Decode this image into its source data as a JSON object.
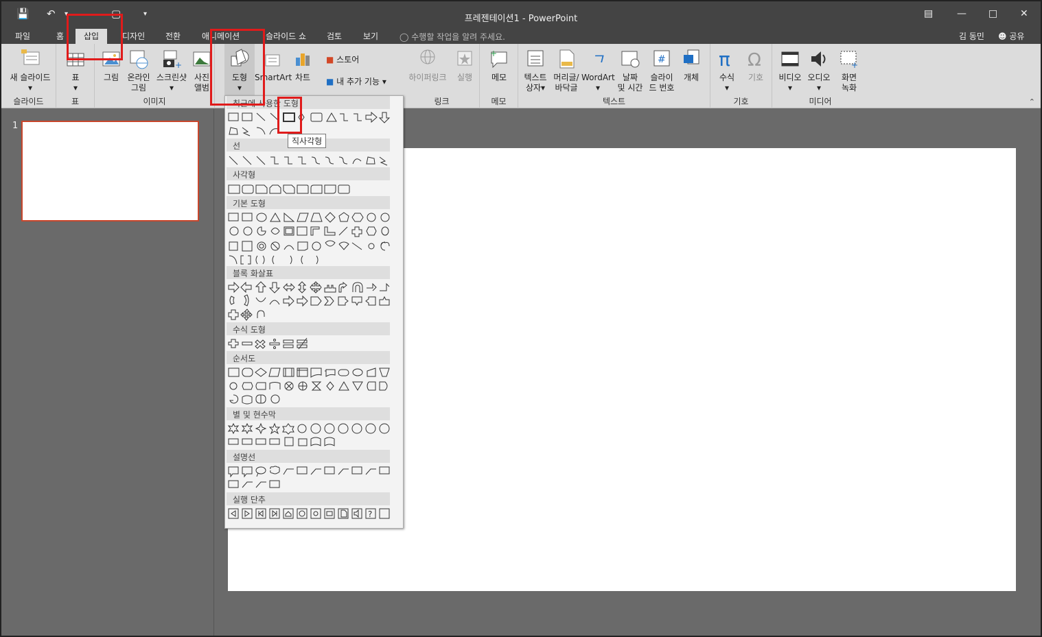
{
  "app": {
    "title": "프레젠테이션1 - PowerPoint",
    "user": "김 동민",
    "share": "공유",
    "tell_me": "수행할 작업을 알려 주세요."
  },
  "tabs": [
    "파일",
    "홈",
    "삽입",
    "디자인",
    "전환",
    "애니메이션",
    "슬라이드 쇼",
    "검토",
    "보기"
  ],
  "ribbon": {
    "groups": {
      "slides": "슬라이드",
      "table": "표",
      "images": "이미지",
      "links": "링크",
      "comments": "메모",
      "text": "텍스트",
      "symbols": "기호",
      "media": "미디어"
    },
    "buttons": {
      "new_slide": "새 슬라이드",
      "table": "표",
      "pictures": "그림",
      "online_pictures": [
        "온라인",
        "그림"
      ],
      "screenshot": "스크린샷",
      "photo_album": [
        "사진",
        "앨범"
      ],
      "shapes": "도형",
      "smartart": "SmartArt",
      "chart": "차트",
      "store": "스토어",
      "my_addins": "내 추가 기능",
      "hyperlink": "하이퍼링크",
      "action": "실행",
      "comment": "메모",
      "textbox": [
        "텍스트",
        "상자"
      ],
      "header_footer": [
        "머리글/",
        "바닥글"
      ],
      "wordart": "WordArt",
      "date_time": [
        "날짜",
        "및 시간"
      ],
      "slide_number": [
        "슬라이",
        "드 번호"
      ],
      "object": "개체",
      "equation": "수식",
      "symbol": "기호",
      "video": "비디오",
      "audio": "오디오",
      "screen_recording": [
        "화면",
        "녹화"
      ]
    }
  },
  "shapes_gallery": {
    "sections": [
      "최근에 사용한 도형",
      "선",
      "사각형",
      "기본 도형",
      "블록 화살표",
      "수식 도형",
      "순서도",
      "별 및 현수막",
      "설명선",
      "실행 단추"
    ],
    "tooltip": "직사각형"
  },
  "slides": {
    "thumbnail_number": "1"
  },
  "colors": {
    "accent": "#c8462c",
    "highlight": "#e01b1b",
    "titlebar": "#444444"
  }
}
